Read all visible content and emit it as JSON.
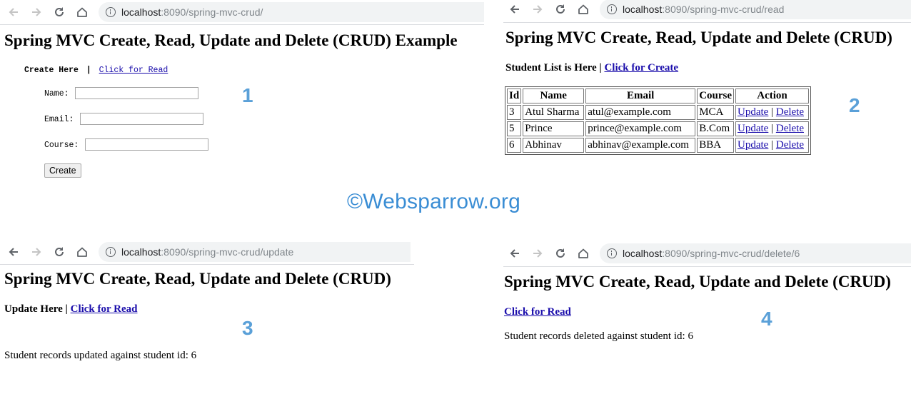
{
  "watermark": "©Websparrow.org",
  "panels": {
    "create": {
      "number": "1",
      "url_host": "localhost",
      "url_path": ":8090/spring-mvc-crud/",
      "title": "Spring MVC Create, Read, Update and Delete (CRUD) Example",
      "subtitle_bold": "Create Here",
      "divider": "|",
      "link_read": "Click for Read",
      "form": {
        "name_label": "Name:",
        "name_value": "",
        "email_label": "Email:",
        "email_value": "",
        "course_label": "Course:",
        "course_value": "",
        "submit_label": "Create"
      }
    },
    "read": {
      "number": "2",
      "url_host": "localhost",
      "url_path": ":8090/spring-mvc-crud/read",
      "title": "Spring MVC Create, Read, Update and Delete (CRUD)",
      "subtitle_bold": "Student List is Here",
      "divider": "|",
      "link_create": "Click for Create",
      "table": {
        "headers": [
          "Id",
          "Name",
          "Email",
          "Course",
          "Action"
        ],
        "rows": [
          {
            "id": "3",
            "name": "Atul Sharma",
            "email": "atul@example.com",
            "course": "MCA",
            "update": "Update",
            "sep": "|",
            "delete": "Delete"
          },
          {
            "id": "5",
            "name": "Prince",
            "email": "prince@example.com",
            "course": "B.Com",
            "update": "Update",
            "sep": "|",
            "delete": "Delete"
          },
          {
            "id": "6",
            "name": "Abhinav",
            "email": "abhinav@example.com",
            "course": "BBA",
            "update": "Update",
            "sep": "|",
            "delete": "Delete"
          }
        ]
      }
    },
    "update": {
      "number": "3",
      "url_host": "localhost",
      "url_path": ":8090/spring-mvc-crud/update",
      "title": "Spring MVC Create, Read, Update and Delete (CRUD)",
      "subtitle_bold": "Update Here",
      "divider": "|",
      "link_read": "Click for Read",
      "message": "Student records updated against student id: 6"
    },
    "delete": {
      "number": "4",
      "url_host": "localhost",
      "url_path": ":8090/spring-mvc-crud/delete/6",
      "title": "Spring MVC Create, Read, Update and Delete (CRUD)",
      "link_read": "Click for Read",
      "message": "Student records deleted against student id: 6"
    }
  }
}
